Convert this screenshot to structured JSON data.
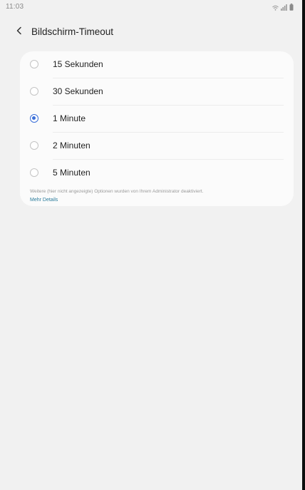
{
  "status_bar": {
    "time": "11:03"
  },
  "header": {
    "title": "Bildschirm-Timeout"
  },
  "timeout_options": [
    {
      "label": "15 Sekunden",
      "selected": false
    },
    {
      "label": "30 Sekunden",
      "selected": false
    },
    {
      "label": "1 Minute",
      "selected": true
    },
    {
      "label": "2 Minuten",
      "selected": false
    },
    {
      "label": "5 Minuten",
      "selected": false
    }
  ],
  "footnote": {
    "text": "Weitere (hier nicht angezeigte) Optionen wurden von Ihrem Administrator deaktiviert.",
    "link": "Mehr Details"
  },
  "colors": {
    "background": "#f1f1f1",
    "card": "#fbfbfb",
    "accent": "#3b6fd8",
    "link": "#2a7b9b"
  },
  "icons": {
    "back": "chevron-left-icon",
    "signal": "signal-icon",
    "battery": "battery-icon"
  }
}
